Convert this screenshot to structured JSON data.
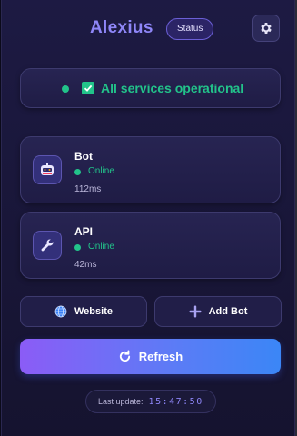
{
  "header": {
    "brand": "Alexius",
    "status_pill": "Status",
    "settings_icon": "gear-icon"
  },
  "health": {
    "text": "All services operational",
    "icon": "check-icon",
    "color": "#22c38a"
  },
  "services": [
    {
      "name": "Bot",
      "status": "Online",
      "latency": "112ms",
      "icon": "bot-icon"
    },
    {
      "name": "API",
      "status": "Online",
      "latency": "42ms",
      "icon": "wrench-icon"
    }
  ],
  "actions": {
    "website_label": "Website",
    "website_icon": "globe-icon",
    "add_bot_label": "Add Bot",
    "add_bot_icon": "plus-icon",
    "refresh_label": "Refresh",
    "refresh_icon": "refresh-icon"
  },
  "footer": {
    "last_update_label": "Last update:",
    "last_update_time": "15:47:50"
  },
  "colors": {
    "accent": "#8e86f7",
    "online": "#22c38a",
    "refresh_start": "#8b5cf6",
    "refresh_end": "#3b86f6"
  }
}
